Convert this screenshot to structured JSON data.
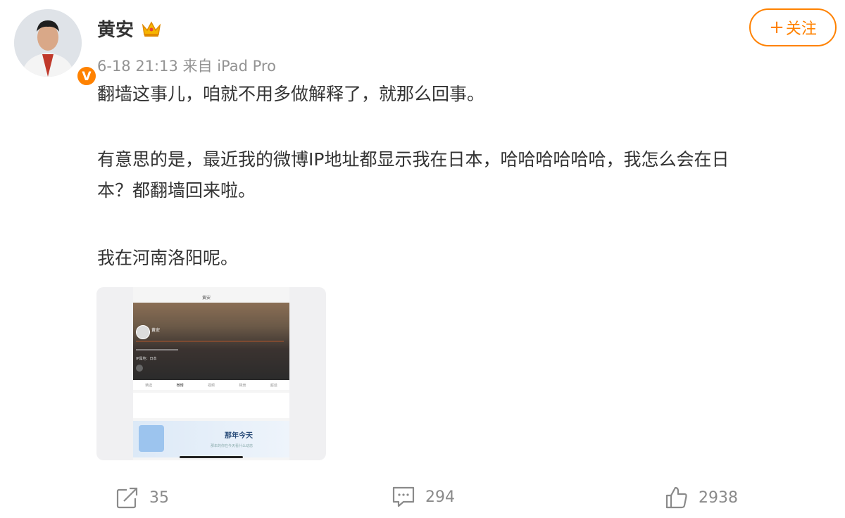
{
  "header": {
    "username": "黄安",
    "verified_badge": "V",
    "meta": "6-18 21:13 来自 iPad Pro",
    "follow_label": "关注",
    "follow_plus": "+"
  },
  "post": {
    "paragraphs": [
      "翻墙这事儿，咱就不用多做解释了，就那么回事。",
      "有意思的是，最近我的微博IP地址都显示我在日本，哈哈哈哈哈哈，我怎么会在日",
      "本？都翻墙回来啦。",
      "我在河南洛阳呢。"
    ]
  },
  "screenshot": {
    "title": "黄安",
    "name": "黄安",
    "ip_line": "IP属地：日本",
    "tabs": [
      "精选",
      "微博",
      "视频",
      "相册",
      "超话"
    ],
    "calendar_title": "那年今天",
    "calendar_sub": "那年的你在今天看什么动态"
  },
  "actions": {
    "repost_count": "35",
    "comment_count": "294",
    "like_count": "2938"
  },
  "colors": {
    "accent": "#ff8200",
    "muted": "#939393"
  }
}
